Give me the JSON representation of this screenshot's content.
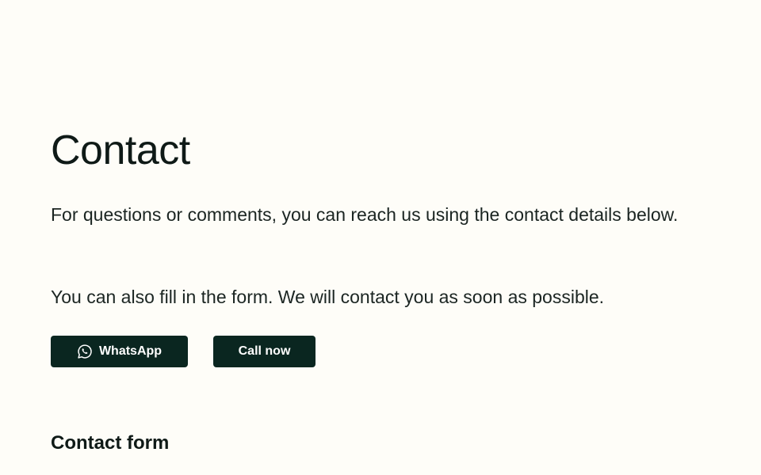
{
  "page": {
    "title": "Contact",
    "intro": "For questions or comments, you can reach us using the contact details below.",
    "form_note": "You can also fill in the form. We will contact you as soon as possible."
  },
  "actions": {
    "whatsapp_label": "WhatsApp",
    "whatsapp_icon": "whatsapp-icon",
    "call_label": "Call now"
  },
  "form_section": {
    "title": "Contact form"
  },
  "colors": {
    "background": "#fefdf8",
    "button": "#0a2620",
    "text": "#0f1a17"
  }
}
